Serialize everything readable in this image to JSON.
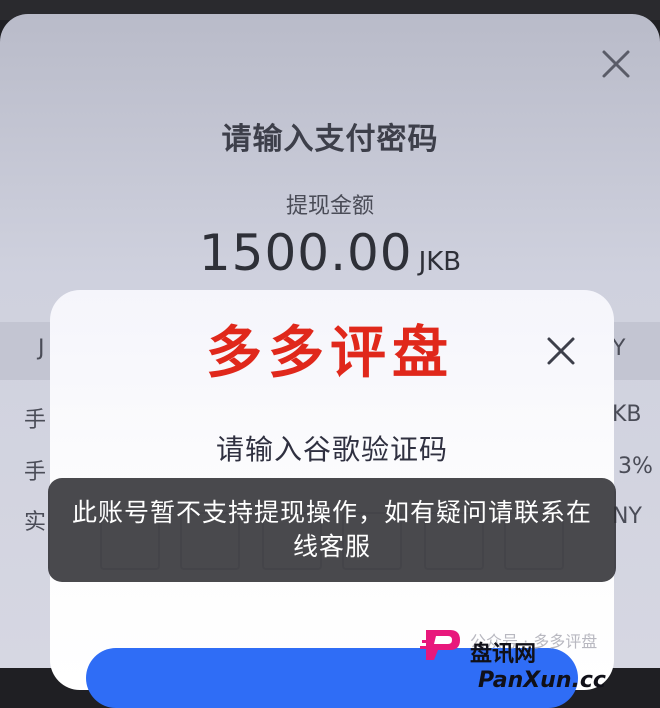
{
  "base_dialog": {
    "title": "请输入支付密码",
    "amount_label": "提现金额",
    "amount_value": "1500.00",
    "amount_currency": "JKB",
    "select_left_partial": "J",
    "select_right_partial": "Y",
    "rows": [
      {
        "left_partial": "手",
        "right_partial": "KB"
      },
      {
        "left_partial": "手",
        "right_partial": "3%"
      },
      {
        "left_partial": "实",
        "right_partial": "NY"
      }
    ]
  },
  "watermark_top": "多多评盘",
  "verify_modal": {
    "title": "请输入谷歌验证码",
    "code_boxes": 6
  },
  "toast": {
    "message": "此账号暂不支持提现操作，如有疑问请联系在线客服"
  },
  "watermark_bottom": {
    "faint_text": "公众号 · 多多评盘",
    "site_name": "盘讯网",
    "site_domain": "PanXun.cc",
    "logo_color": "#e8187c"
  },
  "colors": {
    "accent_blue": "#2f6df6",
    "watermark_red": "#e0281b"
  }
}
